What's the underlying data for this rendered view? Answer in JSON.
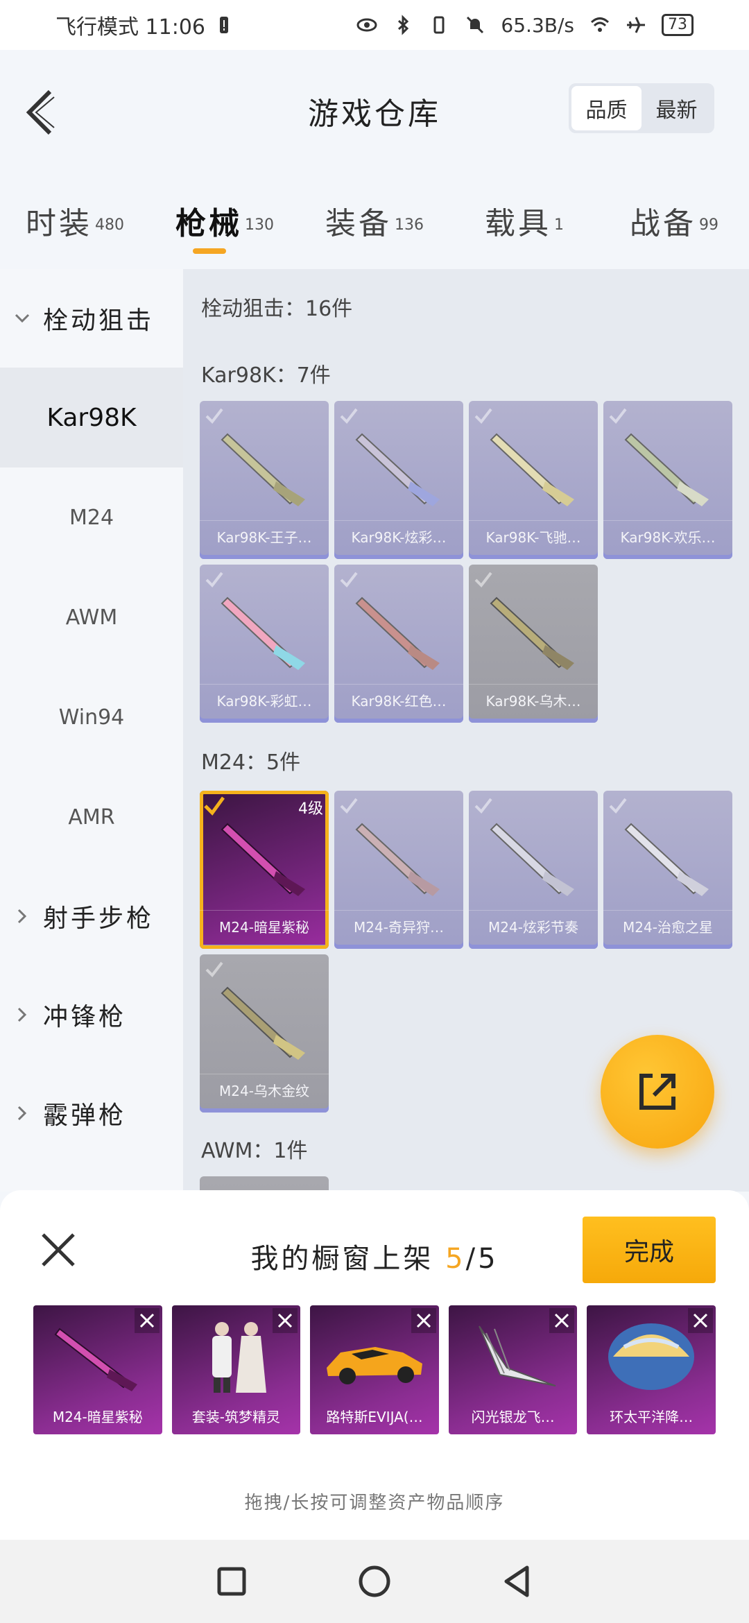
{
  "status_bar": {
    "left_text": "飞行模式 11:06",
    "speed": "65.3B/s",
    "battery": "73"
  },
  "header": {
    "title": "游戏仓库",
    "sort_options": [
      "品质",
      "最新"
    ]
  },
  "tabs": [
    {
      "label": "时装",
      "count": "480"
    },
    {
      "label": "枪械",
      "count": "130"
    },
    {
      "label": "装备",
      "count": "136"
    },
    {
      "label": "载具",
      "count": "1"
    },
    {
      "label": "战备",
      "count": "99"
    }
  ],
  "left_nav": {
    "group_open": "栓动狙击",
    "items": [
      "Kar98K",
      "M24",
      "AWM",
      "Win94",
      "AMR"
    ],
    "groups_closed": [
      "射手步枪",
      "冲锋枪",
      "霰弹枪"
    ]
  },
  "content": {
    "category_title": "栓动狙击：16件",
    "kar_title": "Kar98K：7件",
    "kar_items": [
      "Kar98K-王子…",
      "Kar98K-炫彩…",
      "Kar98K-飞驰…",
      "Kar98K-欢乐…",
      "Kar98K-彩虹…",
      "Kar98K-红色…",
      "Kar98K-乌木…"
    ],
    "m24_title": "M24：5件",
    "m24_items": [
      "M24-暗星紫秘",
      "M24-奇异狩…",
      "M24-炫彩节奏",
      "M24-治愈之星",
      "M24-乌木金纹"
    ],
    "m24_tier": "4级",
    "awm_title": "AWM：1件"
  },
  "sheet": {
    "title": "我的橱窗上架",
    "count_current": "5",
    "count_total": "/5",
    "done_label": "完成",
    "items": [
      "M24-暗星紫秘",
      "套装-筑梦精灵",
      "路特斯EVIJA(…",
      "闪光银龙飞…",
      "环太平洋降…"
    ],
    "hint": "拖拽/长按可调整资产物品顺序"
  },
  "colors": {
    "accent": "#f5a623",
    "card_purple": "#7c2784",
    "card_lavender": "#a9a9cc"
  }
}
